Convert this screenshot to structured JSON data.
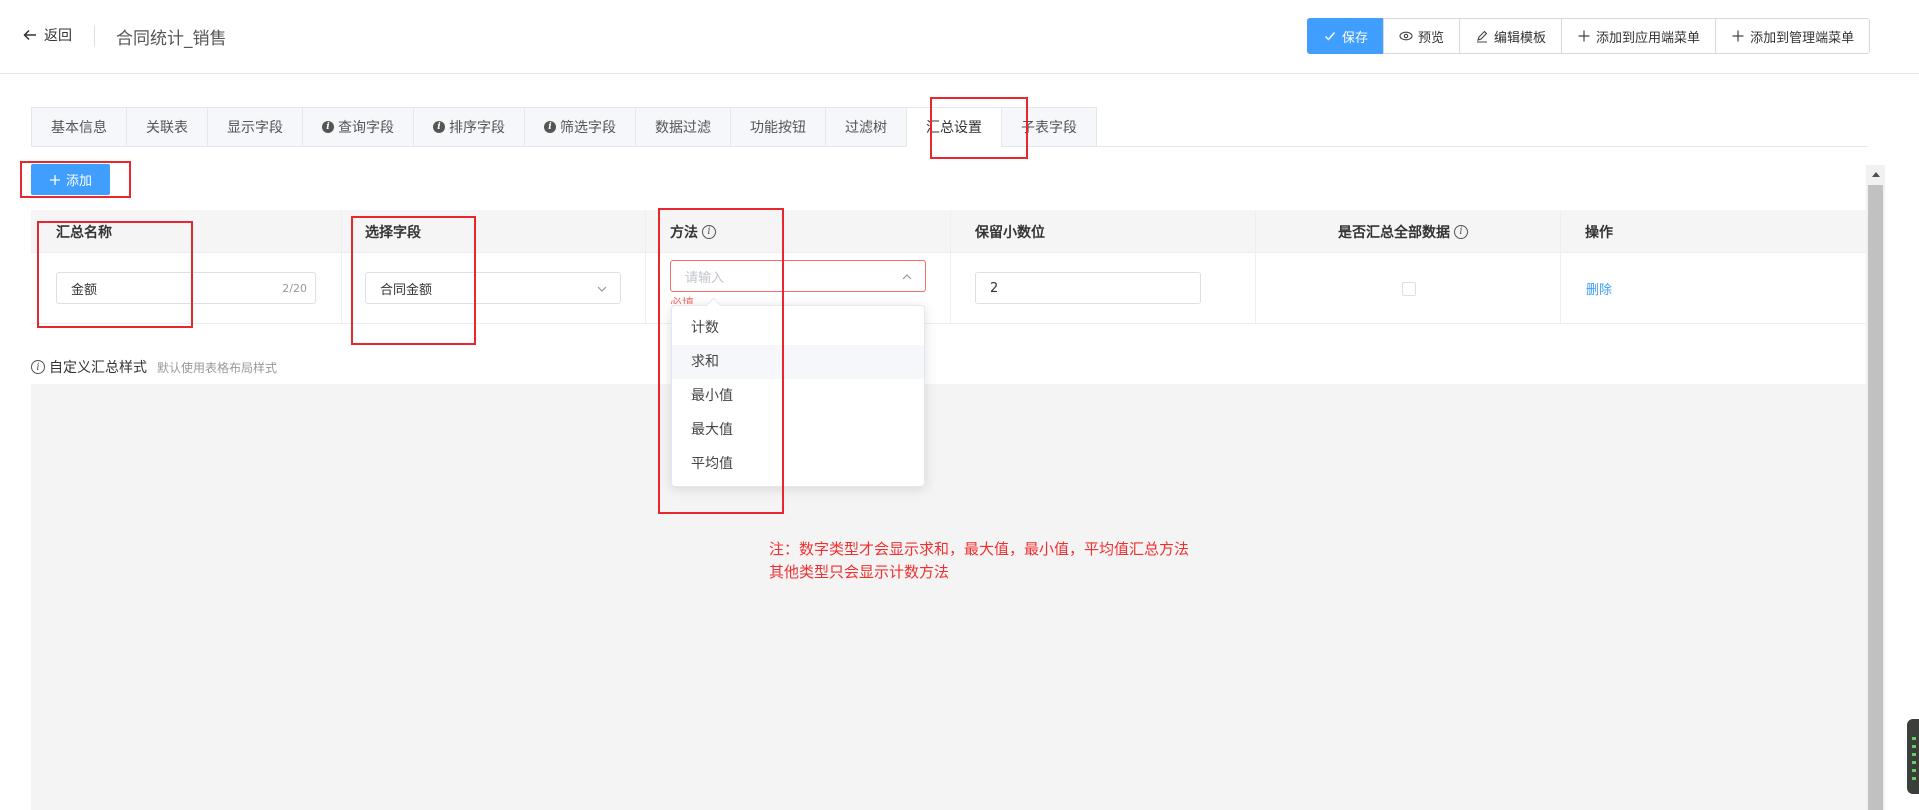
{
  "header": {
    "back_label": "返回",
    "title": "合同统计_销售",
    "buttons": {
      "save": "保存",
      "preview": "预览",
      "edit_template": "编辑模板",
      "add_app_menu": "添加到应用端菜单",
      "add_admin_menu": "添加到管理端菜单"
    }
  },
  "tabs": [
    {
      "label": "基本信息"
    },
    {
      "label": "关联表"
    },
    {
      "label": "显示字段"
    },
    {
      "label": "查询字段"
    },
    {
      "label": "排序字段"
    },
    {
      "label": "筛选字段"
    },
    {
      "label": "数据过滤"
    },
    {
      "label": "功能按钮"
    },
    {
      "label": "过滤树"
    },
    {
      "label": "汇总设置"
    },
    {
      "label": "子表字段"
    }
  ],
  "active_tab": "汇总设置",
  "toolbar": {
    "add_label": "添加"
  },
  "table": {
    "headers": {
      "name": "汇总名称",
      "field": "选择字段",
      "method": "方法",
      "decimals": "保留小数位",
      "all_data": "是否汇总全部数据",
      "ops": "操作"
    },
    "row": {
      "name_value": "金额",
      "name_count": "2/20",
      "field_value": "合同金额",
      "method_placeholder": "请输入",
      "method_error": "必填",
      "decimals_value": "2",
      "all_data_checked": false,
      "delete_label": "删除"
    }
  },
  "method_options": [
    "计数",
    "求和",
    "最小值",
    "最大值",
    "平均值"
  ],
  "custom_style": {
    "label": "自定义汇总样式",
    "hint": "默认使用表格布局样式"
  },
  "note": {
    "line1": "注：数字类型才会显示求和，最大值，最小值，平均值汇总方法",
    "line2": "其他类型只会显示计数方法"
  },
  "colors": {
    "primary": "#409eff",
    "annotation_red": "#e8262e",
    "note_red": "#f03030"
  }
}
